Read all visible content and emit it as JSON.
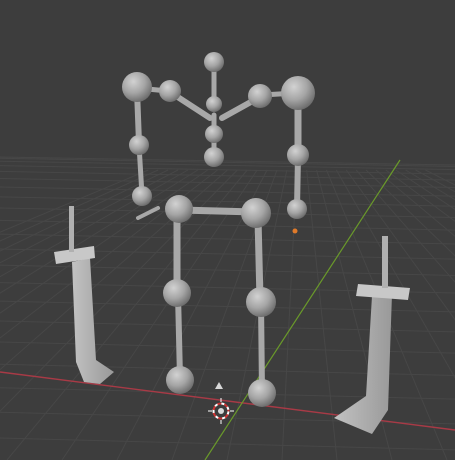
{
  "viewport": {
    "name": "3D Viewport",
    "background_color": "#3d3d3d",
    "grid_color": "#474747",
    "x_axis_color": "#a83a46",
    "y_axis_color": "#6a9a2a"
  },
  "scene": {
    "objects": [
      {
        "name": "armature-rig",
        "type": "armature",
        "color": "#a9a9a9"
      },
      {
        "name": "sword-left",
        "type": "mesh",
        "color": "#b4b4b4"
      },
      {
        "name": "sword-right",
        "type": "mesh",
        "color": "#b4b4b4"
      }
    ],
    "gizmos": [
      "3d-cursor",
      "light-origin"
    ]
  }
}
